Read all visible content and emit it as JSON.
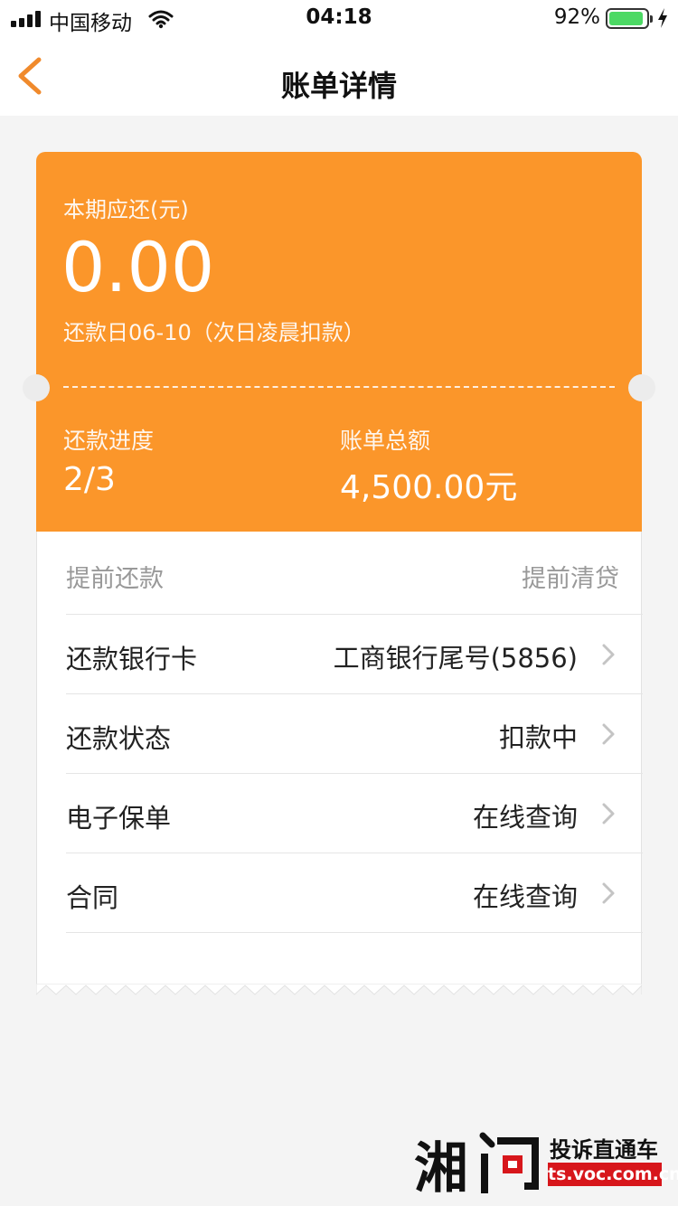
{
  "status_bar": {
    "carrier": "中国移动",
    "time": "04:18",
    "battery_percent": "92%",
    "battery_level": 0.92,
    "icons": [
      "signal-icon",
      "wifi-icon",
      "battery-icon",
      "charging-bolt-icon"
    ]
  },
  "nav": {
    "title": "账单详情",
    "back_icon": "chevron-left-icon",
    "accent_color": "#f08a2c"
  },
  "bill": {
    "due_label": "本期应还(元)",
    "due_amount": "0.00",
    "due_date": "还款日06-10（次日凌晨扣款）",
    "progress_label": "还款进度",
    "progress_value": "2/3",
    "total_label": "账单总额",
    "total_value": "4,500.00元",
    "card_color": "#fb962a"
  },
  "prepay": {
    "left": "提前还款",
    "right": "提前清贷"
  },
  "rows": [
    {
      "label": "还款银行卡",
      "value": "工商银行尾号(5856)"
    },
    {
      "label": "还款状态",
      "value": "扣款中"
    },
    {
      "label": "电子保单",
      "value": "在线查询"
    },
    {
      "label": "合同",
      "value": "在线查询"
    }
  ],
  "watermark": {
    "title": "投诉直通车",
    "url": "ts.voc.com.cn"
  }
}
